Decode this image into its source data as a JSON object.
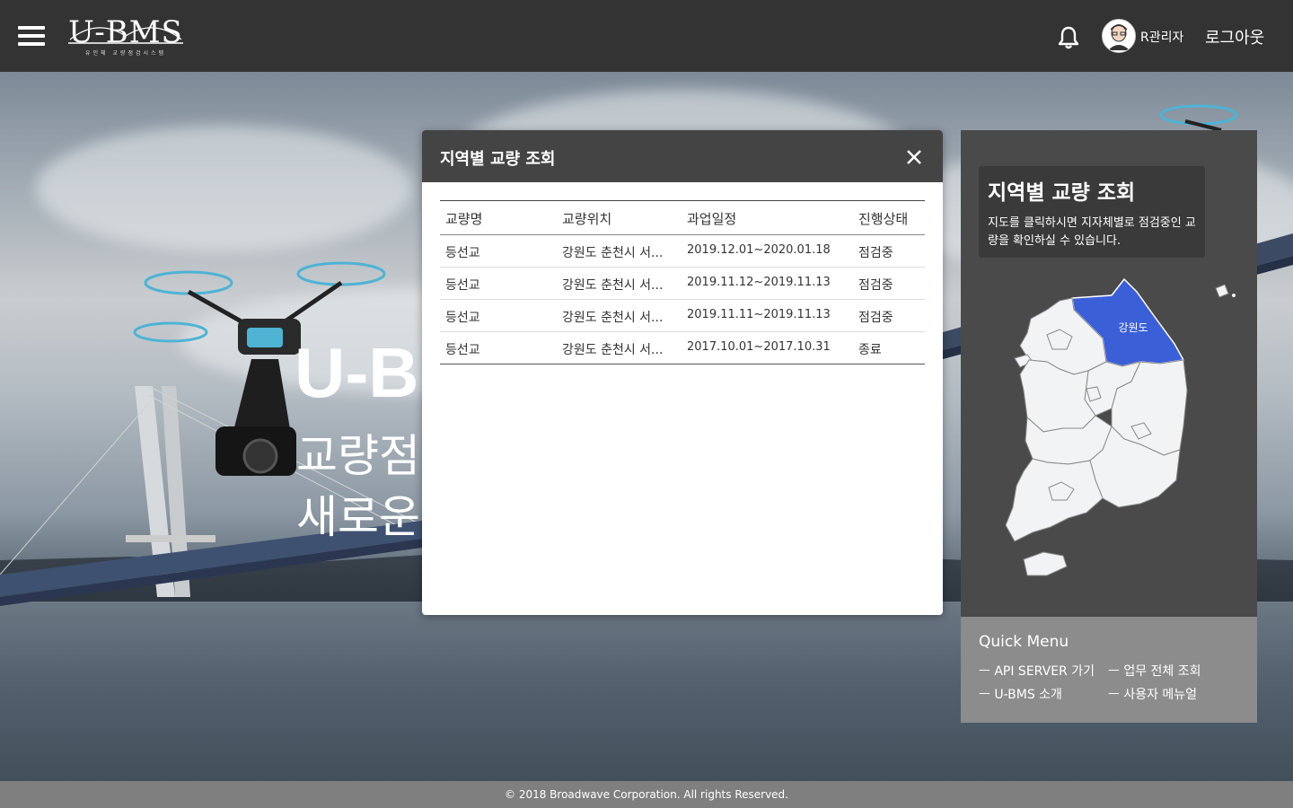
{
  "header": {
    "logo_text": "U-BMS",
    "logo_sub": "유인체 교량점검시스템",
    "user_name": "R관리자",
    "logout_label": "로그아웃"
  },
  "hero": {
    "title": "U-B",
    "line1": "교량점",
    "line2": "새로운"
  },
  "modal": {
    "title": "지역별 교량 조회",
    "columns": [
      "교량명",
      "교량위치",
      "과업일정",
      "진행상태"
    ],
    "rows": [
      [
        "등선교",
        "강원도 춘천시 서...",
        "2019.12.01~2020.01.18",
        "점검중"
      ],
      [
        "등선교",
        "강원도 춘천시 서...",
        "2019.11.12~2019.11.13",
        "점검중"
      ],
      [
        "등선교",
        "강원도 춘천시 서...",
        "2019.11.11~2019.11.13",
        "점검중"
      ],
      [
        "등선교",
        "강원도 춘천시 서...",
        "2017.10.01~2017.10.31",
        "종료"
      ]
    ]
  },
  "panel": {
    "title": "지역별 교량 조회",
    "description": "지도를 클릭하시면 지자체별로 점검중인 교량을 확인하실 수 있습니다.",
    "selected_region": "강원도",
    "selected_color": "#3b5fd6",
    "quick_menu_title": "Quick Menu",
    "quick_menu": [
      "ㅡ API SERVER 가기",
      "ㅡ 업무 전체 조회",
      "ㅡ U-BMS 소개",
      "ㅡ 사용자 메뉴얼"
    ]
  },
  "footer": {
    "copyright": "© 2018 Broadwave Corporation. All rights Reserved."
  },
  "icons": [
    "menu-icon",
    "bell-icon",
    "avatar-icon",
    "close-icon"
  ]
}
